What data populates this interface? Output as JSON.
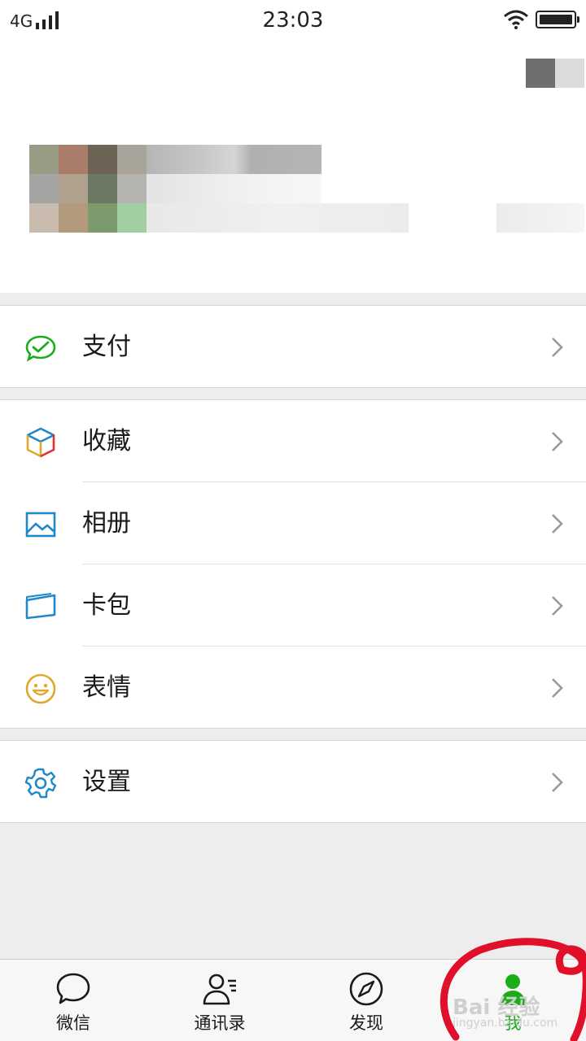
{
  "status": {
    "network": "4G",
    "time": "23:03"
  },
  "menu": {
    "pay": {
      "label": "支付",
      "icon": "wallet-check-icon"
    },
    "favorites": {
      "label": "收藏",
      "icon": "cube-icon"
    },
    "album": {
      "label": "相册",
      "icon": "picture-icon"
    },
    "cards": {
      "label": "卡包",
      "icon": "card-icon"
    },
    "stickers": {
      "label": "表情",
      "icon": "smile-icon"
    },
    "settings": {
      "label": "设置",
      "icon": "gear-icon"
    }
  },
  "tabs": [
    {
      "label": "微信",
      "icon": "chat-bubble-icon"
    },
    {
      "label": "通讯录",
      "icon": "contacts-icon"
    },
    {
      "label": "发现",
      "icon": "compass-icon"
    },
    {
      "label": "我",
      "icon": "person-icon",
      "active": true
    }
  ],
  "watermark": {
    "brand": "Bai 经验",
    "url": "jingyan.baidu.com"
  },
  "colors": {
    "accent_green": "#1aad19",
    "annotation_red": "#e0102a",
    "icon_blue": "#1f88c9",
    "icon_yellow": "#e0a82e"
  }
}
